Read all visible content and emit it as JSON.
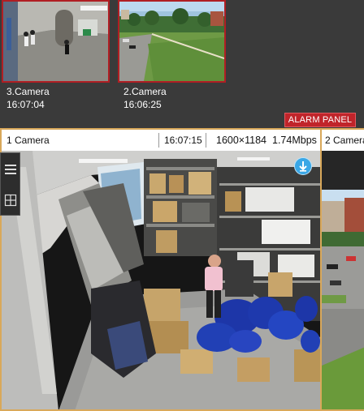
{
  "alarms": [
    {
      "camera": "3.Camera",
      "time": "16:07:04"
    },
    {
      "camera": "2.Camera",
      "time": "16:06:25"
    }
  ],
  "alarm_panel_label": "ALARM PANEL",
  "cameras": [
    {
      "name": "1 Camera",
      "time": "16:07:15",
      "resolution": "1600×1184",
      "bitrate": "1.74Mbps"
    },
    {
      "name": "2 Camera"
    }
  ],
  "icons": {
    "ptz": "ptz-arrow-down-icon",
    "menu": "menu-icon",
    "grid": "grid-layout-icon"
  },
  "colors": {
    "alarm_red": "#c0242a",
    "active_border": "#d9a85a",
    "ptz_blue": "#3aa7e6"
  }
}
